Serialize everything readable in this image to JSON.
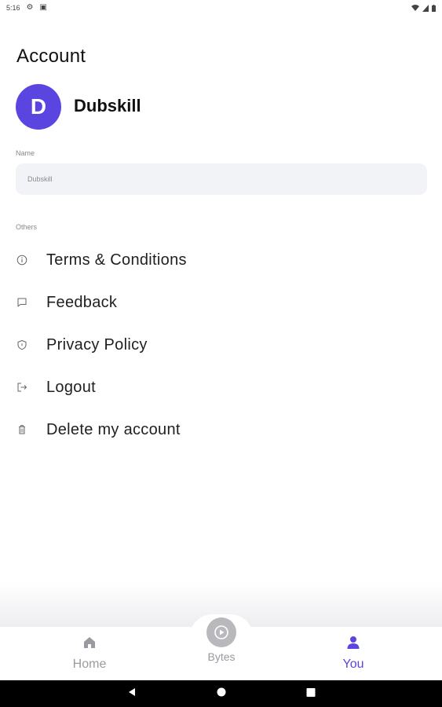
{
  "status_bar": {
    "time": "5:16",
    "icons": [
      "gear-icon",
      "notification-icon",
      "wifi-icon",
      "signal-icon",
      "battery-icon"
    ]
  },
  "page": {
    "title": "Account"
  },
  "profile": {
    "avatar_letter": "D",
    "avatar_color": "#5b45e0",
    "name": "Dubskill"
  },
  "name_field": {
    "label": "Name",
    "value": "Dubskill"
  },
  "others": {
    "label": "Others",
    "items": [
      {
        "label": "Terms & Conditions",
        "icon": "info-icon"
      },
      {
        "label": "Feedback",
        "icon": "feedback-icon"
      },
      {
        "label": "Privacy Policy",
        "icon": "shield-icon"
      },
      {
        "label": "Logout",
        "icon": "logout-icon"
      },
      {
        "label": "Delete my account",
        "icon": "trash-icon"
      }
    ]
  },
  "bottom_nav": {
    "items": [
      {
        "label": "Home",
        "icon": "home-icon",
        "active": false
      },
      {
        "label": "Bytes",
        "icon": "play-icon",
        "active": false
      },
      {
        "label": "You",
        "icon": "person-icon",
        "active": true
      }
    ],
    "active_color": "#5b45e0",
    "inactive_color": "#9a9aa0"
  },
  "system_nav": {
    "buttons": [
      "back-icon",
      "home-circle-icon",
      "recents-icon"
    ]
  }
}
